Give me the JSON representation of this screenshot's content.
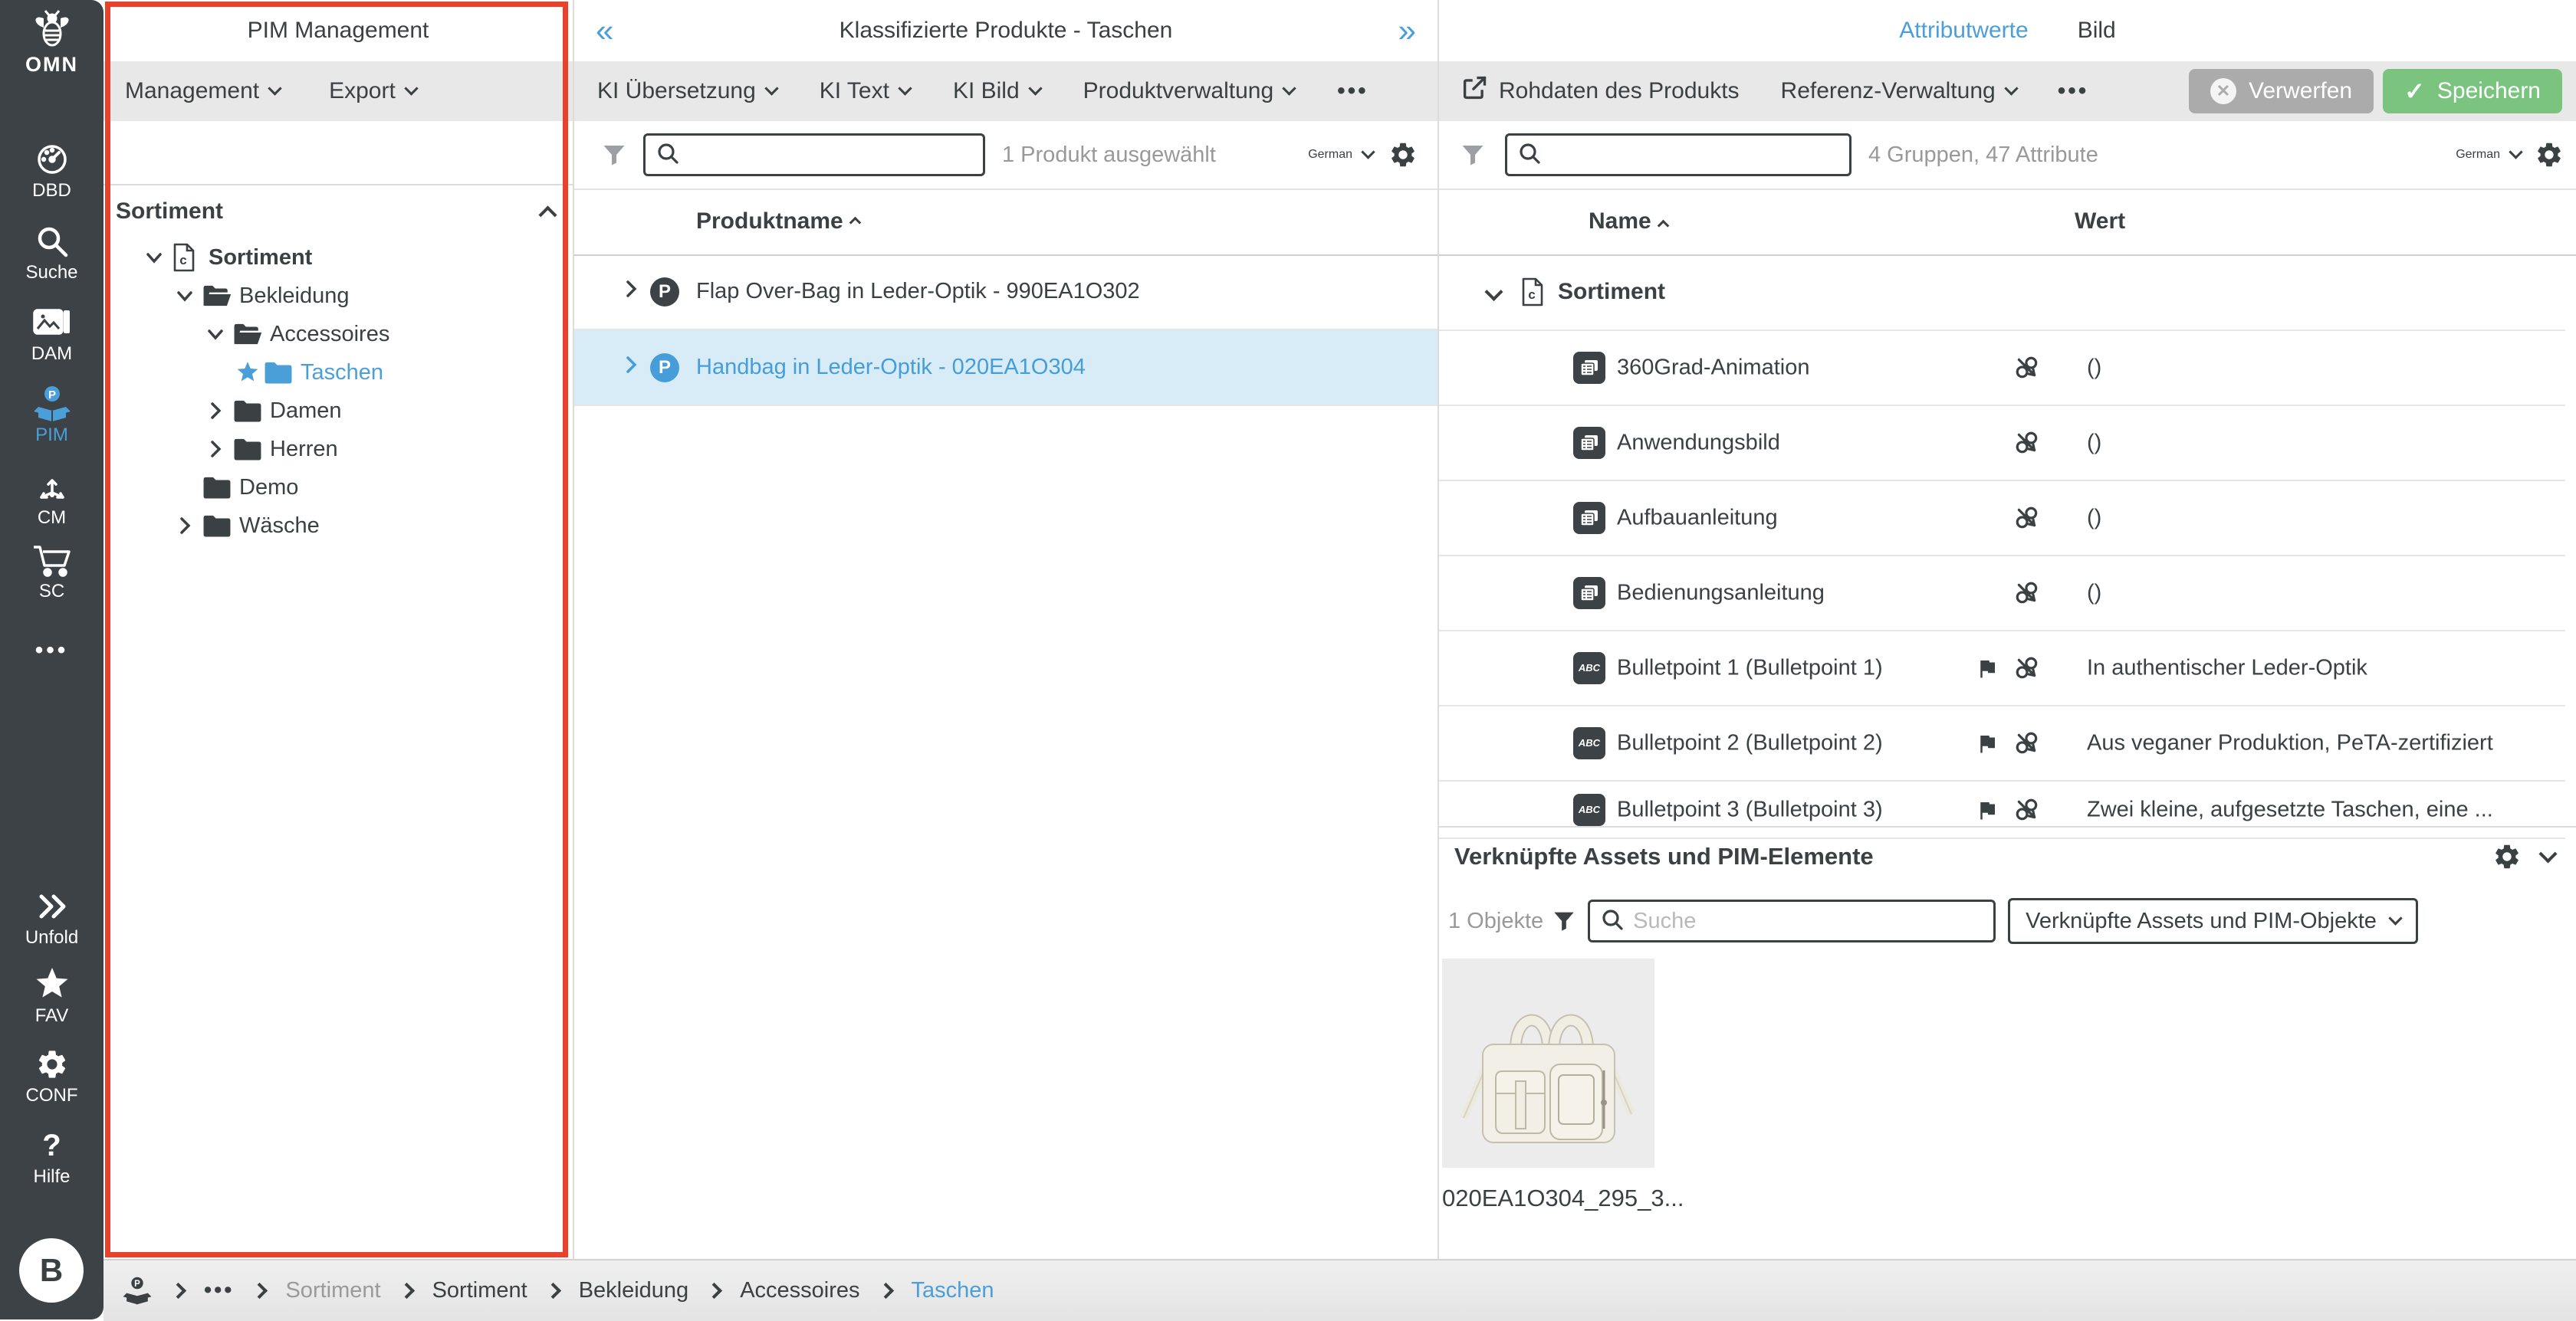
{
  "colors": {
    "accent_blue": "#4a9fd9",
    "annotation_red": "#e8422c",
    "save_green": "#7ac47f",
    "discard_gray": "#ababab",
    "selected_row_bg": "#d8ecf8",
    "sidebar_bg": "#3d4246"
  },
  "glyphs": {
    "collapse_left": "«",
    "collapse_right": "»",
    "ellipsis": "•••",
    "question": "?",
    "star": "★",
    "check": "✓",
    "x": "✕"
  },
  "sidebar": {
    "logo": {
      "label": "OMN",
      "icon": "bee-icon"
    },
    "items": [
      {
        "id": "dbd",
        "label": "DBD",
        "icon": "gauge-icon",
        "active": false
      },
      {
        "id": "suche",
        "label": "Suche",
        "icon": "search-icon",
        "active": false
      },
      {
        "id": "dam",
        "label": "DAM",
        "icon": "image-card-icon",
        "active": false
      },
      {
        "id": "pim",
        "label": "PIM",
        "icon": "pim-box-icon",
        "active": true
      },
      {
        "id": "cm",
        "label": "CM",
        "icon": "branch-arrows-icon",
        "active": false
      },
      {
        "id": "sc",
        "label": "SC",
        "icon": "cart-icon",
        "active": false
      }
    ],
    "more_icon": "ellipsis-icon",
    "bottom_items": [
      {
        "id": "unfold",
        "label": "Unfold",
        "icon": "double-chevron-right-icon"
      },
      {
        "id": "fav",
        "label": "FAV",
        "icon": "star-icon"
      },
      {
        "id": "conf",
        "label": "CONF",
        "icon": "gear-icon"
      },
      {
        "id": "hilfe",
        "label": "Hilfe",
        "icon": "question-icon"
      }
    ],
    "avatar": "B"
  },
  "pim_panel": {
    "title": "PIM Management",
    "menus": [
      {
        "label": "Management"
      },
      {
        "label": "Export"
      }
    ],
    "tree_header": "Sortiment",
    "tree": [
      {
        "label": "Sortiment",
        "level": 0,
        "icon": "classification-doc-icon",
        "expander": "down",
        "bold": true,
        "selected": false
      },
      {
        "label": "Bekleidung",
        "level": 1,
        "icon": "folder-open-icon",
        "expander": "down",
        "bold": false,
        "selected": false
      },
      {
        "label": "Accessoires",
        "level": 2,
        "icon": "folder-open-icon",
        "expander": "down",
        "bold": false,
        "selected": false
      },
      {
        "label": "Taschen",
        "level": 3,
        "icon": "folder-closed-icon",
        "expander": "star",
        "bold": false,
        "selected": true
      },
      {
        "label": "Damen",
        "level": 2,
        "icon": "folder-closed-icon",
        "expander": "right",
        "bold": false,
        "selected": false
      },
      {
        "label": "Herren",
        "level": 2,
        "icon": "folder-closed-icon",
        "expander": "right",
        "bold": false,
        "selected": false
      },
      {
        "label": "Demo",
        "level": 1,
        "icon": "folder-closed-icon",
        "expander": "none",
        "bold": false,
        "selected": false
      },
      {
        "label": "Wäsche",
        "level": 1,
        "icon": "folder-closed-icon",
        "expander": "right",
        "bold": false,
        "selected": false
      }
    ]
  },
  "product_panel": {
    "title": "Klassifizierte Produkte - Taschen",
    "toolbar": [
      "KI Übersetzung",
      "KI Text",
      "KI Bild",
      "Produktverwaltung"
    ],
    "selection_status": "1 Produkt ausgewählt",
    "language": "German",
    "search_value": "",
    "column_header": "Produktname",
    "rows": [
      {
        "name": "Flap Over-Bag in Leder-Optik - 990EA1O302",
        "selected": false
      },
      {
        "name": "Handbag in Leder-Optik - 020EA1O304",
        "selected": true
      }
    ]
  },
  "detail_panel": {
    "tabs": [
      {
        "label": "Attributwerte",
        "active": true
      },
      {
        "label": "Bild",
        "active": false
      }
    ],
    "toolbar": {
      "raw_data": "Rohdaten des Produkts",
      "reference": "Referenz-Verwaltung"
    },
    "buttons": {
      "discard": "Verwerfen",
      "save": "Speichern"
    },
    "status": "4 Gruppen, 47 Attribute",
    "language": "German",
    "search_value": "",
    "columns": {
      "name": "Name",
      "value": "Wert"
    },
    "group": {
      "label": "Sortiment",
      "icon": "classification-doc-icon"
    },
    "attributes": [
      {
        "name": "360Grad-Animation",
        "type": "media",
        "flag": false,
        "value": "()"
      },
      {
        "name": "Anwendungsbild",
        "type": "media",
        "flag": false,
        "value": "()"
      },
      {
        "name": "Aufbauanleitung",
        "type": "media",
        "flag": false,
        "value": "()"
      },
      {
        "name": "Bedienungsanleitung",
        "type": "media",
        "flag": false,
        "value": "()"
      },
      {
        "name": "Bulletpoint 1 (Bulletpoint 1)",
        "type": "text",
        "flag": true,
        "value": "In authentischer Leder-Optik"
      },
      {
        "name": "Bulletpoint 2 (Bulletpoint 2)",
        "type": "text",
        "flag": true,
        "value": "Aus veganer Produktion, PeTA-zertifiziert"
      },
      {
        "name": "Bulletpoint 3 (Bulletpoint 3)",
        "type": "text",
        "flag": true,
        "value": "Zwei kleine, aufgesetzte Taschen, eine ..."
      }
    ],
    "linked_section": {
      "title": "Verknüpfte Assets und PIM-Elemente",
      "count_label": "1 Objekte",
      "search_placeholder": "Suche",
      "filter_dropdown": "Verknüpfte Assets und PIM-Objekte",
      "asset_filename": "020EA1O304_295_3..."
    }
  },
  "breadcrumb": {
    "items": [
      {
        "label": "Sortiment",
        "muted": true,
        "active": false
      },
      {
        "label": "Sortiment",
        "muted": false,
        "active": false
      },
      {
        "label": "Bekleidung",
        "muted": false,
        "active": false
      },
      {
        "label": "Accessoires",
        "muted": false,
        "active": false
      },
      {
        "label": "Taschen",
        "muted": false,
        "active": true
      }
    ]
  }
}
